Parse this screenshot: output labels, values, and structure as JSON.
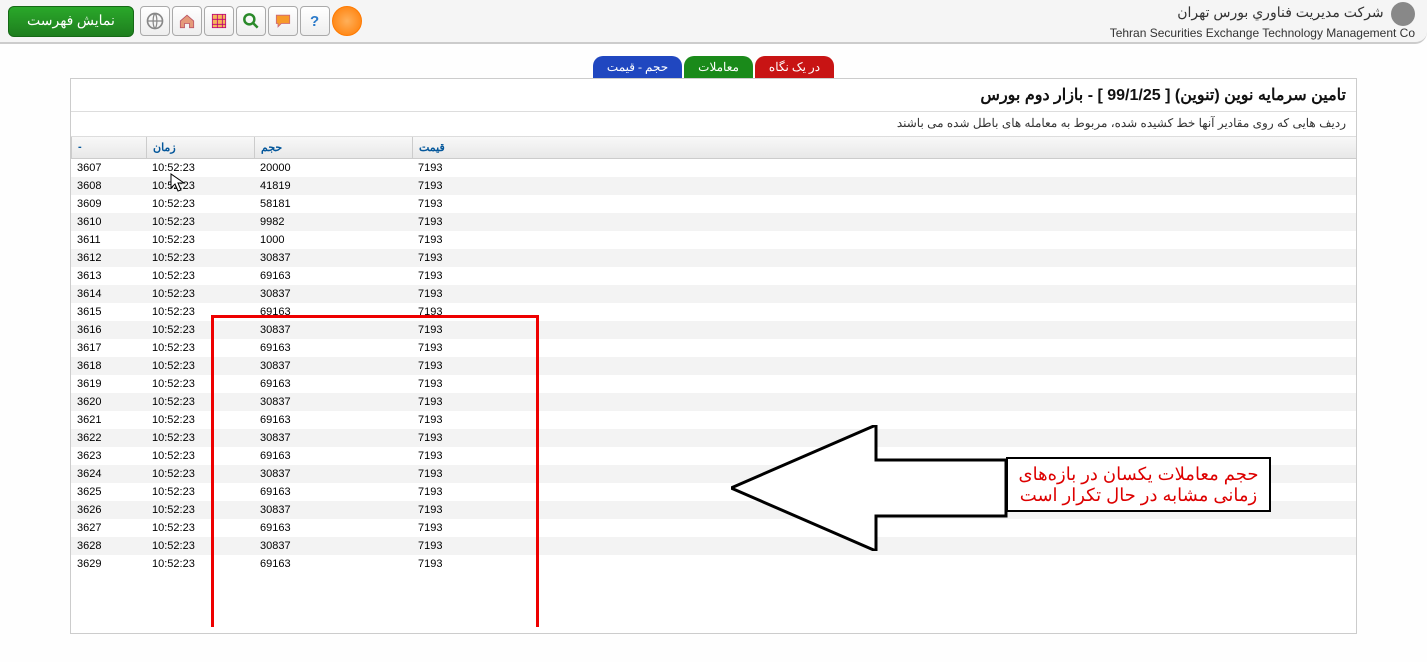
{
  "toolbar": {
    "list_button": "نمایش فهرست"
  },
  "company": {
    "fa": "شرکت مدیریت فناوري بورس تهران",
    "en": "Tehran Securities Exchange Technology Management Co"
  },
  "tabs": {
    "blue": "حجم - قیمت",
    "green": "معاملات",
    "red": "در یک نگاه"
  },
  "panel": {
    "title": "تامین سرمایه نوین (تنوین) [ 99/1/25 ] - بازار دوم بورس",
    "subtitle": "ردیف هایی که روی مقادیر آنها خط کشیده شده، مربوط به معامله های باطل شده می باشند"
  },
  "columns": {
    "idx": "-",
    "time": "زمان",
    "vol": "حجم",
    "price": "قیمت"
  },
  "rows": [
    {
      "idx": "3607",
      "time": "10:52:23",
      "vol": "20000",
      "price": "7193"
    },
    {
      "idx": "3608",
      "time": "10:52:23",
      "vol": "41819",
      "price": "7193"
    },
    {
      "idx": "3609",
      "time": "10:52:23",
      "vol": "58181",
      "price": "7193"
    },
    {
      "idx": "3610",
      "time": "10:52:23",
      "vol": "9982",
      "price": "7193"
    },
    {
      "idx": "3611",
      "time": "10:52:23",
      "vol": "1000",
      "price": "7193"
    },
    {
      "idx": "3612",
      "time": "10:52:23",
      "vol": "30837",
      "price": "7193"
    },
    {
      "idx": "3613",
      "time": "10:52:23",
      "vol": "69163",
      "price": "7193"
    },
    {
      "idx": "3614",
      "time": "10:52:23",
      "vol": "30837",
      "price": "7193"
    },
    {
      "idx": "3615",
      "time": "10:52:23",
      "vol": "69163",
      "price": "7193"
    },
    {
      "idx": "3616",
      "time": "10:52:23",
      "vol": "30837",
      "price": "7193"
    },
    {
      "idx": "3617",
      "time": "10:52:23",
      "vol": "69163",
      "price": "7193"
    },
    {
      "idx": "3618",
      "time": "10:52:23",
      "vol": "30837",
      "price": "7193"
    },
    {
      "idx": "3619",
      "time": "10:52:23",
      "vol": "69163",
      "price": "7193"
    },
    {
      "idx": "3620",
      "time": "10:52:23",
      "vol": "30837",
      "price": "7193"
    },
    {
      "idx": "3621",
      "time": "10:52:23",
      "vol": "69163",
      "price": "7193"
    },
    {
      "idx": "3622",
      "time": "10:52:23",
      "vol": "30837",
      "price": "7193"
    },
    {
      "idx": "3623",
      "time": "10:52:23",
      "vol": "69163",
      "price": "7193"
    },
    {
      "idx": "3624",
      "time": "10:52:23",
      "vol": "30837",
      "price": "7193"
    },
    {
      "idx": "3625",
      "time": "10:52:23",
      "vol": "69163",
      "price": "7193"
    },
    {
      "idx": "3626",
      "time": "10:52:23",
      "vol": "30837",
      "price": "7193"
    },
    {
      "idx": "3627",
      "time": "10:52:23",
      "vol": "69163",
      "price": "7193"
    },
    {
      "idx": "3628",
      "time": "10:52:23",
      "vol": "30837",
      "price": "7193"
    },
    {
      "idx": "3629",
      "time": "10:52:23",
      "vol": "69163",
      "price": "7193"
    }
  ],
  "annotation": {
    "text": "حجم معاملات یکسان در بازه‌های زمانی مشابه در حال تکرار است"
  }
}
